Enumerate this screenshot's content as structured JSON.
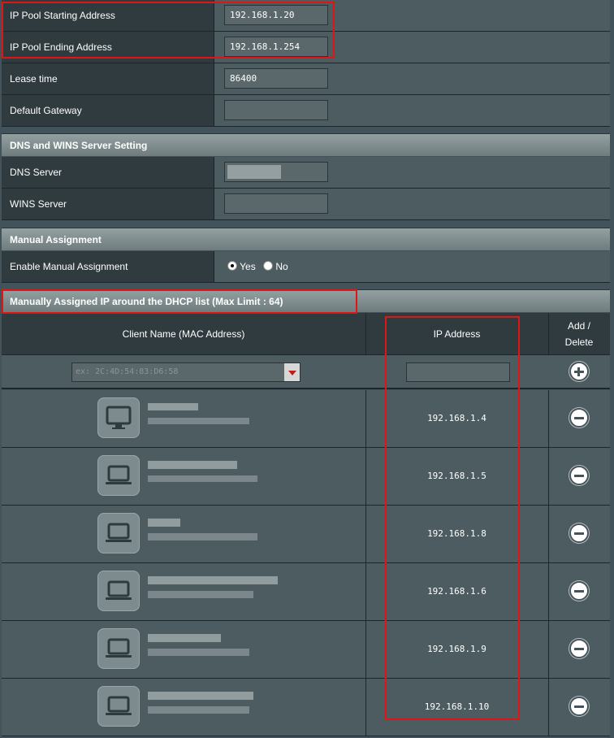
{
  "lan": {
    "ip_pool_start": {
      "label": "IP Pool Starting Address",
      "value": "192.168.1.20"
    },
    "ip_pool_end": {
      "label": "IP Pool Ending Address",
      "value": "192.168.1.254"
    },
    "lease_time": {
      "label": "Lease time",
      "value": "86400"
    },
    "default_gateway": {
      "label": "Default Gateway",
      "value": ""
    }
  },
  "dns_section": {
    "title": "DNS and WINS Server Setting",
    "dns_server": {
      "label": "DNS Server",
      "value": ""
    },
    "wins_server": {
      "label": "WINS Server",
      "value": ""
    }
  },
  "manual_section": {
    "title": "Manual Assignment",
    "enable": {
      "label": "Enable Manual Assignment",
      "yes_label": "Yes",
      "no_label": "No",
      "selected": "Yes"
    }
  },
  "dhcp_list": {
    "title": "Manually Assigned IP around the DHCP list (Max Limit : 64)",
    "columns": {
      "client": "Client Name (MAC Address)",
      "ip": "IP Address",
      "action_top": "Add /",
      "action_bottom": "Delete"
    },
    "mac_placeholder": "ex: 2C:4D:54:83:D6:58",
    "rows": [
      {
        "ip": "192.168.1.4",
        "device": "desktop"
      },
      {
        "ip": "192.168.1.5",
        "device": "laptop"
      },
      {
        "ip": "192.168.1.8",
        "device": "laptop"
      },
      {
        "ip": "192.168.1.6",
        "device": "laptop"
      },
      {
        "ip": "192.168.1.9",
        "device": "laptop"
      },
      {
        "ip": "192.168.1.10",
        "device": "laptop"
      }
    ]
  },
  "colors": {
    "highlight": "#e01515",
    "panel": "#4d5c60",
    "label_bg": "#2f3b3f"
  }
}
